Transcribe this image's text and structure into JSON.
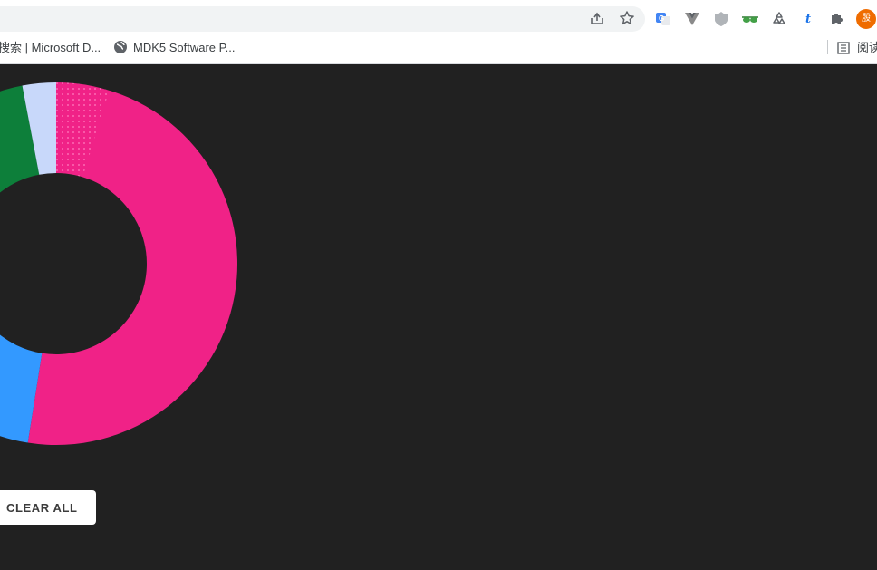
{
  "browser": {
    "omnibox_placeholder": "",
    "bookmarks": [
      {
        "label": "搜索 | Microsoft D...",
        "icon": "none"
      },
      {
        "label": "MDK5 Software P...",
        "icon": "globe-icon"
      }
    ],
    "reading_list_label": "阅读",
    "avatar_text": "殷",
    "omnibox_icons": [
      "share-icon",
      "star-icon"
    ],
    "extensions": [
      "google-translate-icon",
      "vue-devtools-icon",
      "shield-ext-icon",
      "glasses-ext-icon",
      "recycle-icon",
      "t-ext-icon",
      "puzzle-icon"
    ]
  },
  "main": {
    "clear_button_label": "CLEAR ALL"
  },
  "chart_data": {
    "type": "pie",
    "variant": "donut",
    "slices": [
      {
        "color": "#f02287",
        "value": 52.5,
        "pattern": "dots-partial"
      },
      {
        "color": "#3399ff",
        "value": 20
      },
      {
        "color": "#0d7f3a",
        "value": 24.5
      },
      {
        "color": "#c8d8fa",
        "value": 3
      }
    ],
    "colors": {
      "background": "#212121"
    }
  }
}
